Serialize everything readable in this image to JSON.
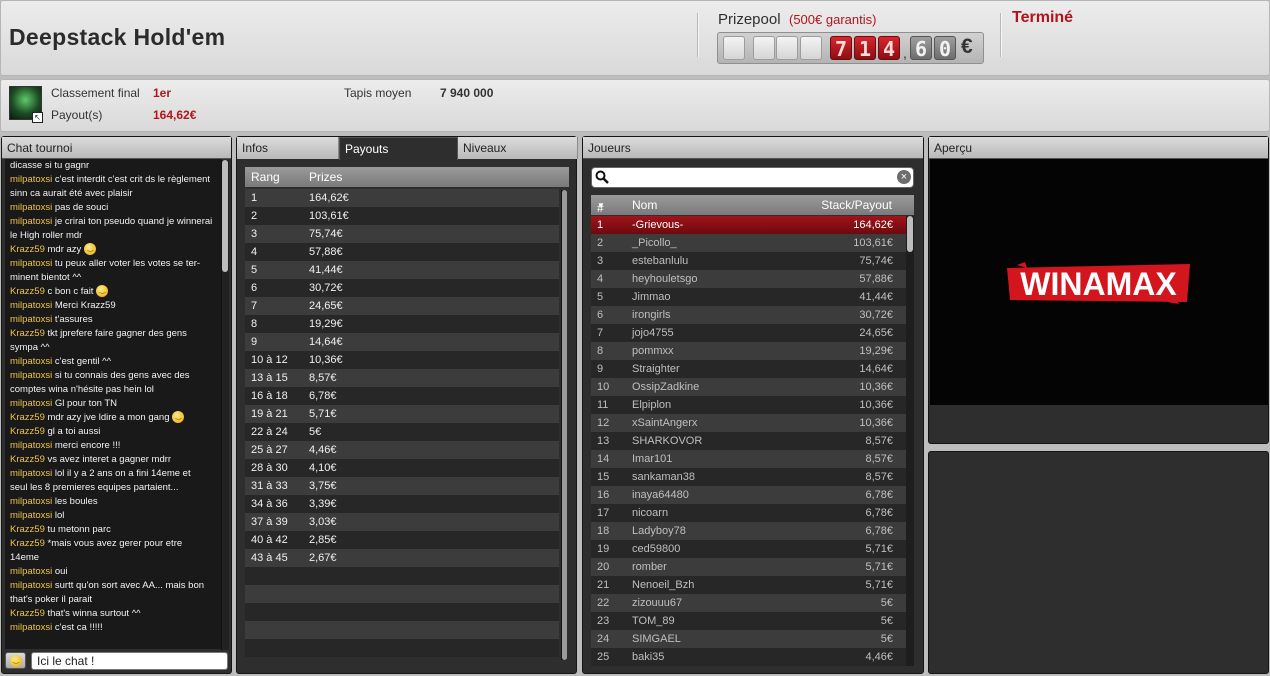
{
  "header": {
    "title": "Deepstack Hold'em",
    "prizepool_label": "Prizepool",
    "prizepool_guarantee": "(500€ garantis)",
    "digits": [
      "",
      "",
      "",
      "",
      "7",
      "1",
      "4",
      "6",
      "0"
    ],
    "comma": ",",
    "currency": "€",
    "status": "Terminé"
  },
  "info": {
    "rank_label": "Classement final",
    "rank_value": "1er",
    "payout_label": "Payout(s)",
    "payout_value": "164,62€",
    "avg_stack_label": "Tapis moyen",
    "avg_stack_value": "7 940 000"
  },
  "chat": {
    "title": "Chat tournoi",
    "input_value": "Ici le chat !",
    "lines": [
      {
        "user": "",
        "text": "dicasse si tu gagnr"
      },
      {
        "user": "milpatoxsi",
        "text": "c'est interdit c'est crit ds le règlement"
      },
      {
        "user": "",
        "text": "sinn ca aurait été avec plaisir"
      },
      {
        "user": "milpatoxsi",
        "text": "pas de souci"
      },
      {
        "user": "milpatoxsi",
        "text": "je crirai ton pseudo quand je winnerai"
      },
      {
        "user": "",
        "text": "le High roller mdr"
      },
      {
        "user": "Krazz59",
        "text": "mdr azy",
        "smiley": true
      },
      {
        "user": "milpatoxsi",
        "text": "tu peux aller voter les votes se ter-"
      },
      {
        "user": "",
        "text": "minent bientot ^^"
      },
      {
        "user": "Krazz59",
        "text": "c bon c fait",
        "smiley": true
      },
      {
        "user": "milpatoxsi",
        "text": "Merci Krazz59"
      },
      {
        "user": "milpatoxsi",
        "text": "t'assures"
      },
      {
        "user": "Krazz59",
        "text": "tkt jprefere faire gagner des gens"
      },
      {
        "user": "",
        "text": "sympa ^^"
      },
      {
        "user": "milpatoxsi",
        "text": "c'est gentil ^^"
      },
      {
        "user": "milpatoxsi",
        "text": "si tu connais des gens avec des"
      },
      {
        "user": "",
        "text": "comptes wina n'hésite pas hein lol"
      },
      {
        "user": "milpatoxsi",
        "text": "Gl pour ton TN"
      },
      {
        "user": "Krazz59",
        "text": "mdr azy jve ldire a mon gang",
        "smiley": true
      },
      {
        "user": "Krazz59",
        "text": "gl a toi aussi"
      },
      {
        "user": "milpatoxsi",
        "text": "merci encore !!!"
      },
      {
        "user": "Krazz59",
        "text": "vs avez interet a gagner mdrr"
      },
      {
        "user": "milpatoxsi",
        "text": "lol il y a 2 ans on a fini 14eme et"
      },
      {
        "user": "",
        "text": "seul les 8 premieres equipes partaient..."
      },
      {
        "user": "milpatoxsi",
        "text": "les boules"
      },
      {
        "user": "milpatoxsi",
        "text": "lol"
      },
      {
        "user": "Krazz59",
        "text": "tu metonn parc"
      },
      {
        "user": "Krazz59",
        "text": "*mais vous avez gerer pour etre"
      },
      {
        "user": "",
        "text": "14eme"
      },
      {
        "user": "milpatoxsi",
        "text": "oui"
      },
      {
        "user": "milpatoxsi",
        "text": "surtt qu'on sort avec AA... mais bon"
      },
      {
        "user": "",
        "text": "that's poker il parait"
      },
      {
        "user": "Krazz59",
        "text": "that's winna surtout ^^"
      },
      {
        "user": "milpatoxsi",
        "text": "c'est ca !!!!!"
      }
    ]
  },
  "tabs": [
    "Infos",
    "Payouts",
    "Niveaux"
  ],
  "payouts": {
    "col_rank": "Rang",
    "col_prize": "Prizes",
    "rows": [
      [
        "1",
        "164,62€"
      ],
      [
        "2",
        "103,61€"
      ],
      [
        "3",
        "75,74€"
      ],
      [
        "4",
        "57,88€"
      ],
      [
        "5",
        "41,44€"
      ],
      [
        "6",
        "30,72€"
      ],
      [
        "7",
        "24,65€"
      ],
      [
        "8",
        "19,29€"
      ],
      [
        "9",
        "14,64€"
      ],
      [
        "10 à 12",
        "10,36€"
      ],
      [
        "13 à 15",
        "8,57€"
      ],
      [
        "16 à 18",
        "6,78€"
      ],
      [
        "19 à 21",
        "5,71€"
      ],
      [
        "22 à 24",
        "5€"
      ],
      [
        "25 à 27",
        "4,46€"
      ],
      [
        "28 à 30",
        "4,10€"
      ],
      [
        "31 à 33",
        "3,75€"
      ],
      [
        "34 à 36",
        "3,39€"
      ],
      [
        "37 à 39",
        "3,03€"
      ],
      [
        "40 à 42",
        "2,85€"
      ],
      [
        "43 à 45",
        "2,67€"
      ],
      [
        "",
        ""
      ],
      [
        "",
        ""
      ],
      [
        "",
        ""
      ],
      [
        "",
        ""
      ],
      [
        "",
        ""
      ]
    ]
  },
  "players": {
    "title": "Joueurs",
    "col_num": "#",
    "col_name": "Nom",
    "col_stack": "Stack/Payout",
    "search_value": "",
    "rows": [
      [
        "1",
        "-Grievous-",
        "164,62€"
      ],
      [
        "2",
        "_Picollo_",
        "103,61€"
      ],
      [
        "3",
        "estebanlulu",
        "75,74€"
      ],
      [
        "4",
        "heyhouletsgo",
        "57,88€"
      ],
      [
        "5",
        "Jimmao",
        "41,44€"
      ],
      [
        "6",
        "irongirls",
        "30,72€"
      ],
      [
        "7",
        "jojo4755",
        "24,65€"
      ],
      [
        "8",
        "pommxx",
        "19,29€"
      ],
      [
        "9",
        "Straighter",
        "14,64€"
      ],
      [
        "10",
        "OssipZadkine",
        "10,36€"
      ],
      [
        "11",
        "Elpiplon",
        "10,36€"
      ],
      [
        "12",
        "xSaintAngerx",
        "10,36€"
      ],
      [
        "13",
        "SHARKOVOR",
        "8,57€"
      ],
      [
        "14",
        "Imar101",
        "8,57€"
      ],
      [
        "15",
        "sankaman38",
        "8,57€"
      ],
      [
        "16",
        "inaya64480",
        "6,78€"
      ],
      [
        "17",
        "nicoarn",
        "6,78€"
      ],
      [
        "18",
        "Ladyboy78",
        "6,78€"
      ],
      [
        "19",
        "ced59800",
        "5,71€"
      ],
      [
        "20",
        "romber",
        "5,71€"
      ],
      [
        "21",
        "Nenoeil_Bzh",
        "5,71€"
      ],
      [
        "22",
        "zizouuu67",
        "5€"
      ],
      [
        "23",
        "TOM_89",
        "5€"
      ],
      [
        "24",
        "SIMGAEL",
        "5€"
      ],
      [
        "25",
        "baki35",
        "4,46€"
      ]
    ]
  },
  "apercu": {
    "title": "Aperçu",
    "logo_text": "WINAMAX"
  },
  "colors": {
    "accent_red": "#b0151b",
    "chat_user": "#efc44a",
    "highlight_row": "#a0141a"
  }
}
